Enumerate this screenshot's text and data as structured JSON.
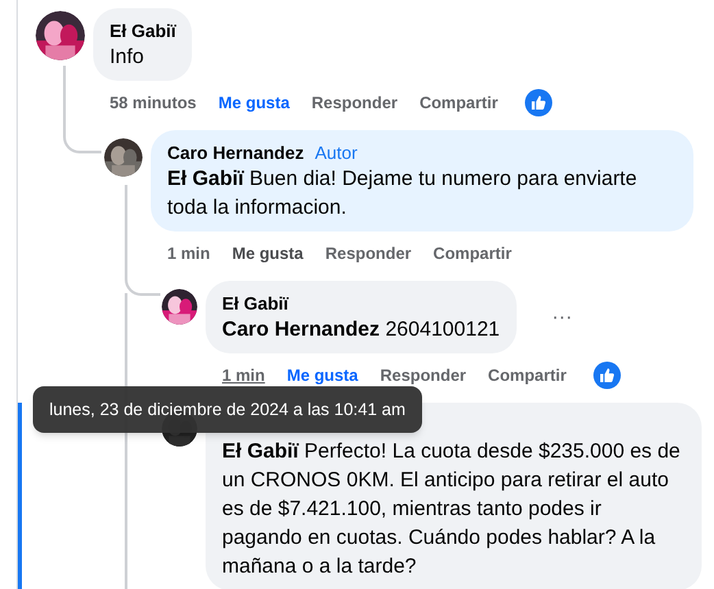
{
  "comments": [
    {
      "author": "Eł Gabiï",
      "text": "Info",
      "time": "58 minutos",
      "like": "Me gusta",
      "liked": true,
      "reply": "Responder",
      "share": "Compartir",
      "reaction": true,
      "children": [
        {
          "author": "Caro Hernandez",
          "badge": "Autor",
          "mention": "Eł Gabiï",
          "text": "Buen dia! Dejame tu numero para enviarte toda la informacion.",
          "time": "1 min",
          "like": "Me gusta",
          "liked": false,
          "reply": "Responder",
          "share": "Compartir",
          "reaction": false,
          "children": [
            {
              "author": "Eł Gabiï",
              "mention": "Caro Hernandez",
              "text": "2604100121",
              "time": "1 min",
              "time_hovered": true,
              "like": "Me gusta",
              "liked": true,
              "reply": "Responder",
              "share": "Compartir",
              "reaction": true,
              "more": "···",
              "tooltip": "lunes, 23 de diciembre de 2024 a las 10:41 am"
            },
            {
              "mention": "Eł Gabiï",
              "text": "Perfecto! La cuota desde $235.000 es de un CRONOS 0KM. El anticipo para retirar el auto es de $7.421.100, mientras tanto podes ir pagando en cuotas. Cuándo podes hablar? A la mañana o a la tarde?",
              "highlighted": true
            }
          ]
        }
      ]
    }
  ]
}
